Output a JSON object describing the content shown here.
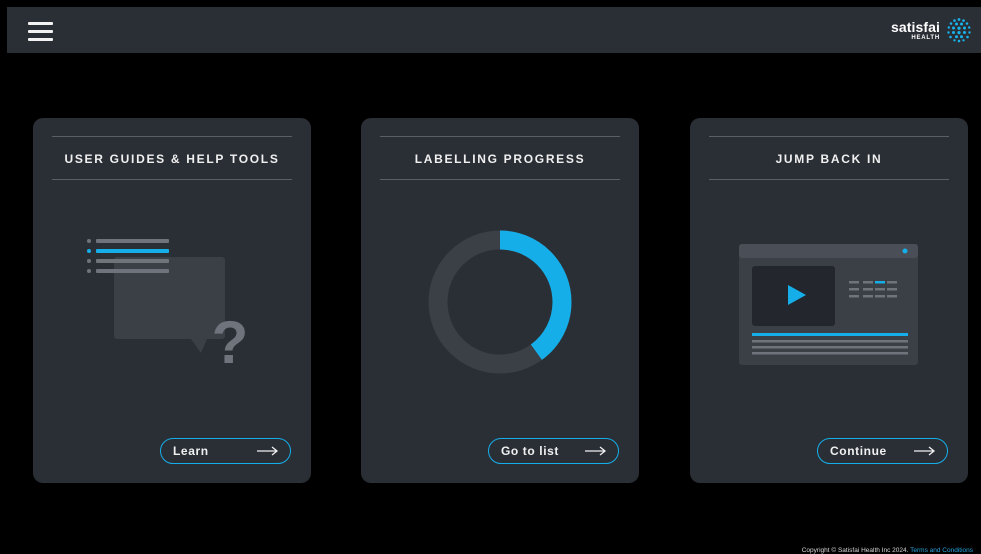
{
  "header": {
    "menu_icon": "hamburger-menu-icon",
    "logo_word": "satisfai",
    "logo_sub": "HEALTH",
    "logo_icon": "dot-sphere-icon"
  },
  "cards": [
    {
      "title": "USER GUIDES & HELP TOOLS",
      "button_label": "Learn",
      "illustration": "help-guide-illustration"
    },
    {
      "title": "LABELLING PROGRESS",
      "button_label": "Go to list",
      "illustration": "progress-donut-chart",
      "progress_fraction": 0.4
    },
    {
      "title": "JUMP BACK IN",
      "button_label": "Continue",
      "illustration": "video-player-illustration"
    }
  ],
  "footer": {
    "copyright": "Copyright © Satisfai Health Inc 2024.",
    "terms_link": "Terms and Conditions"
  },
  "colors": {
    "accent": "#16aee8",
    "background": "#000000",
    "panel": "#2a2e35",
    "muted": "#3b3f46"
  }
}
